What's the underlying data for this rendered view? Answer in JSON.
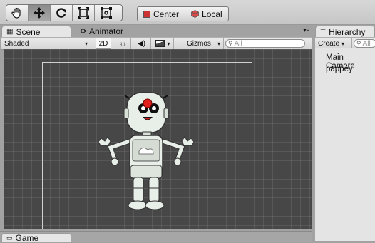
{
  "tools": [
    {
      "name": "hand-tool",
      "icon": "hand-icon"
    },
    {
      "name": "move-tool",
      "icon": "move-arrows-icon"
    },
    {
      "name": "rotate-tool",
      "icon": "rotate-icon"
    },
    {
      "name": "scale-tool",
      "icon": "scale-icon"
    },
    {
      "name": "rect-tool",
      "icon": "rect-transform-icon"
    }
  ],
  "pivot": {
    "center_label": "Center",
    "local_label": "Local"
  },
  "scene_panel": {
    "tabs": {
      "scene": "Scene",
      "animator": "Animator"
    },
    "toolbar": {
      "render_mode": "Shaded",
      "mode_2d": "2D",
      "gizmos": "Gizmos",
      "search_placeholder": "All"
    }
  },
  "hierarchy": {
    "tab_label": "Hierarchy",
    "create_label": "Create",
    "search_placeholder": "All",
    "items": [
      "Main Camera",
      "pappey"
    ]
  },
  "game_tab": {
    "label": "Game"
  },
  "colors": {
    "scene_bg": "#474747",
    "sprite_body": "#e8eee8",
    "sprite_nose": "#e0201c"
  }
}
